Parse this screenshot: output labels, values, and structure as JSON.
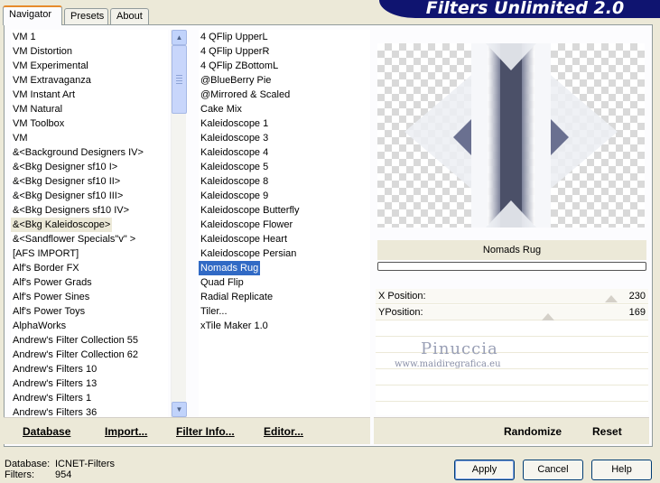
{
  "banner": {
    "title": "Filters Unlimited 2.0"
  },
  "tabs": [
    "Navigator",
    "Presets",
    "About"
  ],
  "categories": {
    "items": [
      "VM 1",
      "VM Distortion",
      "VM Experimental",
      "VM Extravaganza",
      "VM Instant Art",
      "VM Natural",
      "VM Toolbox",
      "VM",
      "&<Background Designers IV>",
      "&<Bkg Designer sf10 I>",
      "&<Bkg Designer sf10 II>",
      "&<Bkg Designer sf10 III>",
      "&<Bkg Designers sf10 IV>",
      "&<Bkg Kaleidoscope>",
      "&<Sandflower Specials\"v\" >",
      "[AFS IMPORT]",
      "Alf's Border FX",
      "Alf's Power Grads",
      "Alf's Power Sines",
      "Alf's Power Toys",
      "AlphaWorks",
      "Andrew's Filter Collection 55",
      "Andrew's Filter Collection 62",
      "Andrew's Filters 10",
      "Andrew's Filters 13",
      "Andrew's Filters 1",
      "Andrew's Filters 36"
    ],
    "selected_index": 13
  },
  "filters": {
    "items": [
      "4 QFlip UpperL",
      "4 QFlip UpperR",
      "4 QFlip ZBottomL",
      "@BlueBerry Pie",
      "@Mirrored & Scaled",
      "Cake Mix",
      "Kaleidoscope 1",
      "Kaleidoscope 3",
      "Kaleidoscope 4",
      "Kaleidoscope 5",
      "Kaleidoscope 8",
      "Kaleidoscope 9",
      "Kaleidoscope Butterfly",
      "Kaleidoscope Flower",
      "Kaleidoscope Heart",
      "Kaleidoscope Persian",
      "Nomads Rug",
      "Quad Flip",
      "Radial Replicate",
      "Tiler...",
      "xTile Maker 1.0"
    ],
    "selected_index": 16
  },
  "left_bar": {
    "database": "Database",
    "import": "Import...",
    "filter_info": "Filter Info...",
    "editor": "Editor..."
  },
  "right_bar": {
    "randomize": "Randomize",
    "reset": "Reset"
  },
  "preview": {
    "filter_name": "Nomads Rug"
  },
  "params": [
    {
      "label": "X Position:",
      "value": "230",
      "level": 0.9
    },
    {
      "label": "YPosition:",
      "value": "169",
      "level": 0.66
    }
  ],
  "watermark": {
    "name": "Pinuccia",
    "url": "www.maidiregrafica.eu"
  },
  "status": {
    "database_label": "Database:",
    "database_value": "ICNET-Filters",
    "filters_label": "Filters:",
    "filters_value": "954"
  },
  "buttons": {
    "apply": "Apply",
    "cancel": "Cancel",
    "help": "Help"
  }
}
